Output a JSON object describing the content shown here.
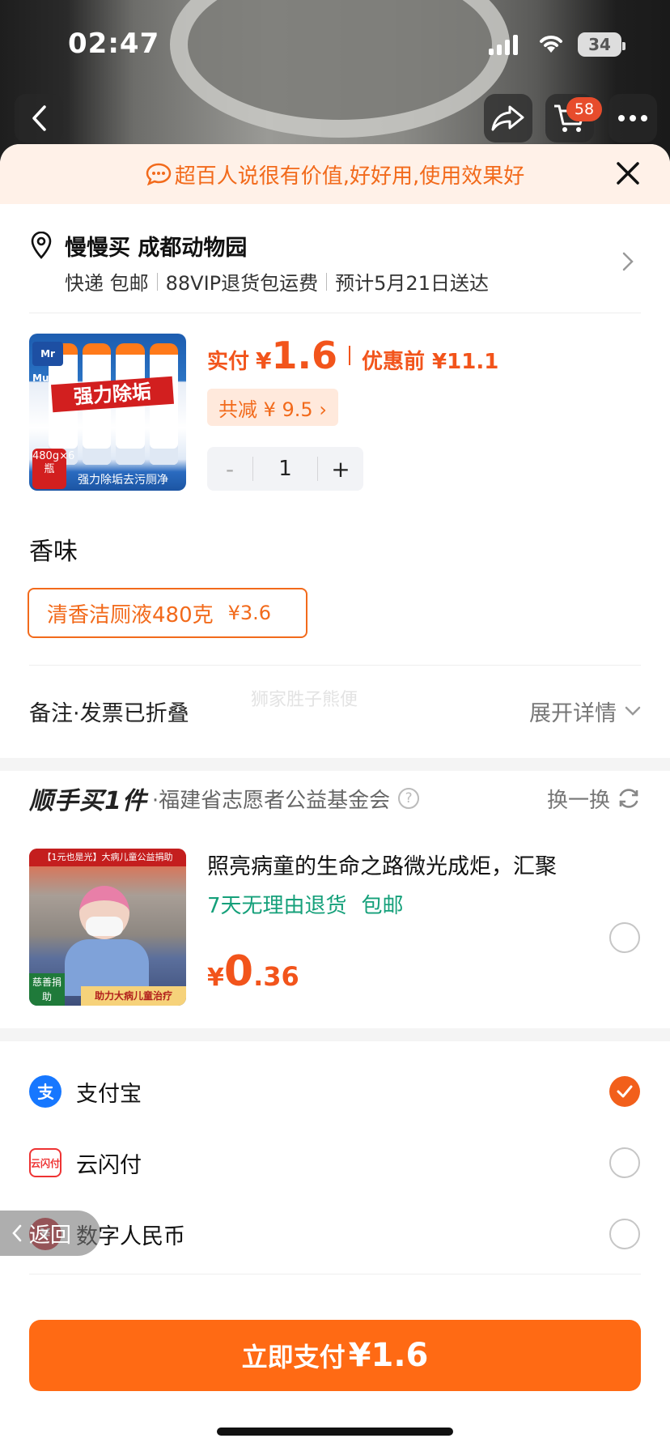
{
  "status": {
    "time": "02:47",
    "battery": "34"
  },
  "nav": {
    "cart_count": "58"
  },
  "banner": {
    "text": "超百人说很有价值,好好用,使用效果好"
  },
  "address": {
    "name": "慢慢买 成都动物园",
    "shipping": "快递 包邮",
    "vip": "88VIP退货包运费",
    "eta": "预计5月21日送达"
  },
  "product": {
    "image_label": "强力除垢",
    "image_bottom": "强力除垢去污厕净",
    "image_badge": "480g×6瓶",
    "image_logo": "Mr Muscle",
    "pay_label": "实付",
    "currency": "¥",
    "price": "1.6",
    "orig_label": "优惠前 ¥11.1",
    "discount": "共减 ¥ 9.5 ›",
    "qty": "1",
    "minus": "-",
    "plus": "+"
  },
  "spec": {
    "title": "香味",
    "option_name": "清香洁厕液480克",
    "option_price": "¥3.6"
  },
  "note": {
    "left": "备注·发票已折叠",
    "right": "展开详情",
    "watermark": "狮家胜子熊便"
  },
  "donate": {
    "logo": "顺手买1件",
    "org": "·福建省志愿者公益基金会",
    "help": "?",
    "swap": "换一换",
    "title": "照亮病童的生命之路微光成炬，汇聚",
    "tag1": "7天无理由退货",
    "tag2": "包邮",
    "currency": "¥",
    "price_int": "0",
    "price_dec": ".36",
    "img_top": "【1元也是光】大病儿童公益捐助",
    "img_tag1": "慈善捐助",
    "img_tag2": "助力大病儿童治疗"
  },
  "payment": {
    "methods": [
      {
        "name": "支付宝",
        "icon": "alipay-icon",
        "selected": true
      },
      {
        "name": "云闪付",
        "icon": "unionpay-icon",
        "selected": false
      },
      {
        "name": "数字人民币",
        "icon": "ecny-icon",
        "selected": false
      }
    ]
  },
  "back_pill": {
    "label": "返回"
  },
  "pay_button": {
    "label": "立即支付",
    "amount": "¥1.6"
  },
  "colors": {
    "accent": "#f26a1b",
    "button": "#ff6a14",
    "green": "#15a07a",
    "alipay": "#1677ff"
  }
}
